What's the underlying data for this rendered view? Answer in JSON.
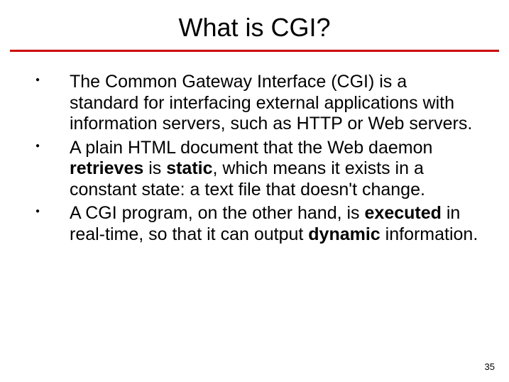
{
  "title": "What is CGI?",
  "bullets": [
    {
      "pre": "The Common Gateway Interface (CGI) is a standard for interfacing external applications with information servers, such as HTTP or Web servers.",
      "b1": "",
      "mid": "",
      "b2": "",
      "post": ""
    },
    {
      "pre": "A plain HTML document that the Web daemon ",
      "b1": "retrieves",
      "mid": " is ",
      "b2": "static",
      "post": ", which means it exists in a constant state: a text file that doesn't change."
    },
    {
      "pre": "A CGI program, on the other hand, is ",
      "b1": "executed",
      "mid": " in real-time, so that it can output ",
      "b2": "dynamic",
      "post": " information."
    }
  ],
  "page_number": "35"
}
